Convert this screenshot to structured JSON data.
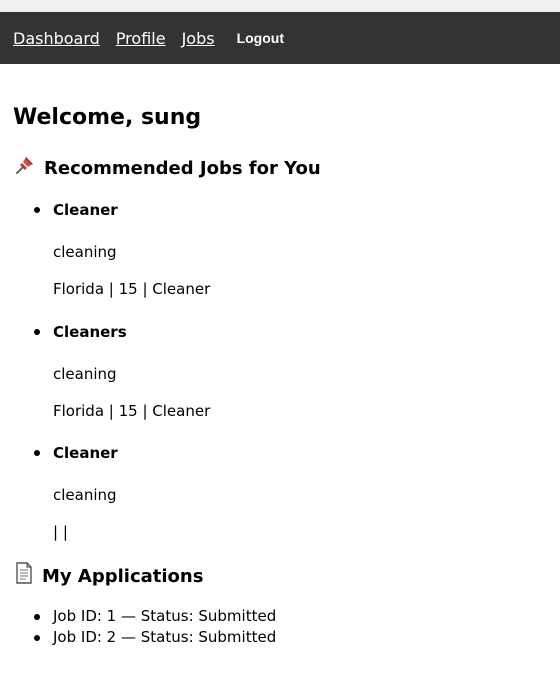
{
  "nav": {
    "links": [
      "Dashboard",
      "Profile",
      "Jobs"
    ],
    "logout_label": "Logout",
    "background": "#333333"
  },
  "welcome": "Welcome, sung",
  "recommended": {
    "icon": "pushpin-icon",
    "title": "Recommended Jobs for You",
    "jobs": [
      {
        "title": "Cleaner",
        "description": "cleaning",
        "meta": "Florida | 15 | Cleaner"
      },
      {
        "title": "Cleaners",
        "description": "cleaning",
        "meta": "Florida | 15 | Cleaner"
      },
      {
        "title": "Cleaner",
        "description": "cleaning",
        "meta": "| |"
      }
    ]
  },
  "applications": {
    "icon": "document-icon",
    "title": "My Applications",
    "items": [
      "Job ID: 1 — Status: Submitted",
      "Job ID: 2 — Status: Submitted"
    ]
  }
}
